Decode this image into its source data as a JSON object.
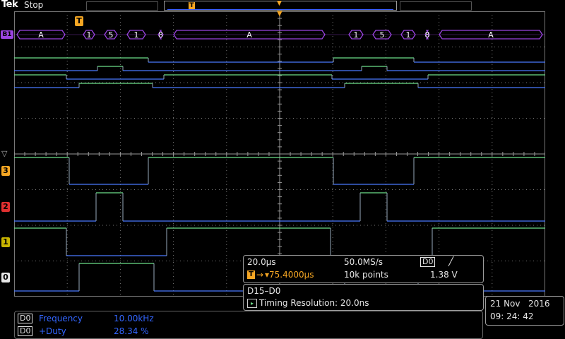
{
  "header": {
    "brand": "Tek",
    "run_state": "Stop",
    "trigger_marker": "T"
  },
  "bus": {
    "label": "B1",
    "segments": [
      "A",
      "1",
      "5",
      "1",
      "8",
      "A",
      "1",
      "5",
      "1",
      "8",
      "A"
    ]
  },
  "channels": [
    "3",
    "2",
    "1",
    "0"
  ],
  "acquisition": {
    "timebase": "20.0µs",
    "sample_rate": "50.0MS/s",
    "trigger_source": "D0",
    "trigger_slope": "╱",
    "trigger_position": "▾75.4000µs",
    "record_length": "10k points",
    "trigger_level": "1.38 V"
  },
  "digital": {
    "range": "D15–D0",
    "timing_resolution": "Timing Resolution: 20.0ns"
  },
  "datetime": {
    "date": "21 Nov   2016",
    "time": "09: 24: 42"
  },
  "measurements": [
    {
      "source": "D0",
      "label": "Frequency",
      "value": "10.00kHz"
    },
    {
      "source": "D0",
      "label": "+Duty",
      "value": "28.34 %"
    }
  ],
  "colors": {
    "bus": "#9a44e0",
    "trace_high": "#6ee08a",
    "trace_low": "#4a7aff",
    "grid": "#777777",
    "trigger": "#f5a623",
    "ch3": "#f5a623",
    "ch2": "#e03030",
    "ch1": "#c8b400",
    "ch0": "#e6e6e6"
  }
}
